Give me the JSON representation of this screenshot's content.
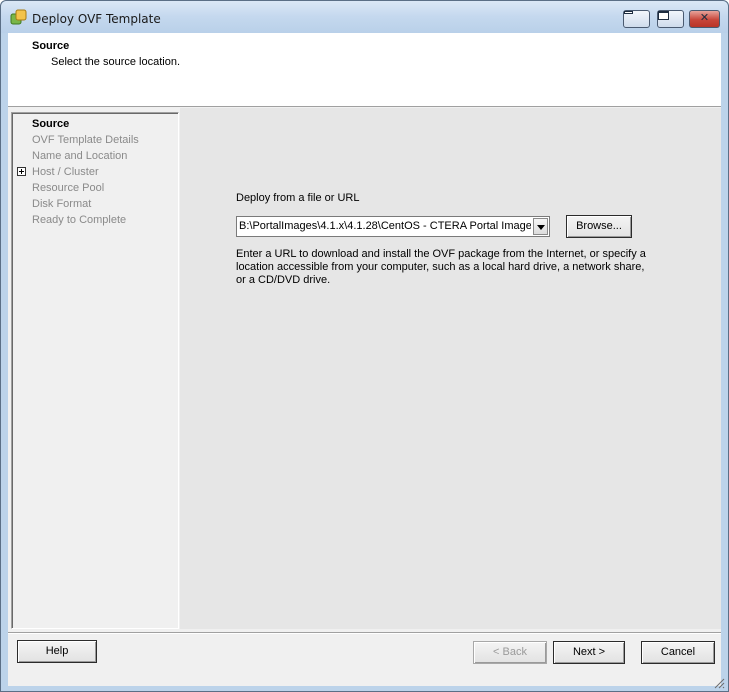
{
  "window": {
    "title": "Deploy OVF Template",
    "icon": "vsphere-app-icon"
  },
  "header": {
    "title": "Source",
    "subtitle": "Select the source location."
  },
  "steps": [
    {
      "label": "Source",
      "active": true
    },
    {
      "label": "OVF Template Details",
      "active": false
    },
    {
      "label": "Name and Location",
      "active": false
    },
    {
      "label": "Host / Cluster",
      "active": false,
      "expandable": true
    },
    {
      "label": "Resource Pool",
      "active": false
    },
    {
      "label": "Disk Format",
      "active": false
    },
    {
      "label": "Ready to Complete",
      "active": false
    }
  ],
  "source": {
    "label": "Deploy from a file or URL",
    "value": "B:\\PortalImages\\4.1.x\\4.1.28\\CentOS - CTERA Portal Image",
    "browse_label": "Browse...",
    "help_text": "Enter a URL to download and install the OVF package from the Internet, or specify a location accessible from your computer, such as a local hard drive, a network share, or a CD/DVD drive."
  },
  "footer": {
    "help_label": "Help",
    "back_label": "< Back",
    "next_label": "Next >",
    "cancel_label": "Cancel"
  },
  "colors": {
    "title_bar": "#c4d8ee",
    "content_bg": "#e6e6e6",
    "inactive_step": "#8a8a8a"
  }
}
